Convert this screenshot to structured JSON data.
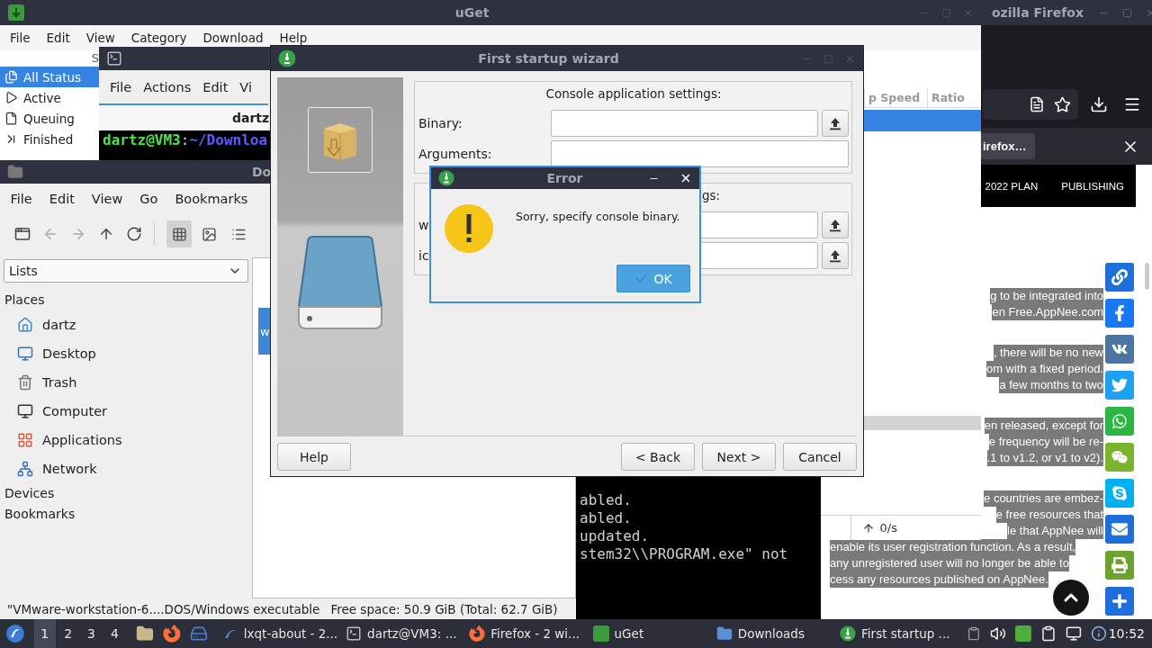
{
  "firefox": {
    "title": "ozilla Firefox",
    "notice": "irefox…",
    "nav": [
      "2022 PLAN",
      "PUBLISHING"
    ],
    "paragraphs": [
      [
        "g to be integrated into",
        "en Free.AppNee.com"
      ],
      [
        ", there will be no new",
        "om with a fixed period.",
        "a few months to two"
      ],
      [
        "en released, except for",
        "e frequency will be re-",
        ".1 to v1.2, or v1 to v2)."
      ],
      [
        "e countries are embez-",
        "e free resources that",
        "le that AppNee will",
        "enable its user registration function. As a result,",
        "any unregistered user will no longer be able to",
        "cess any resources published on AppNee."
      ]
    ]
  },
  "uget": {
    "title": "uGet",
    "menu": [
      "File",
      "Edit",
      "View",
      "Category",
      "Download",
      "Help"
    ],
    "sidebar_header": "S",
    "statuses": [
      {
        "label": "All Status",
        "selected": true
      },
      {
        "label": "Active",
        "selected": false
      },
      {
        "label": "Queuing",
        "selected": false
      },
      {
        "label": "Finished",
        "selected": false
      }
    ],
    "columns": [
      "p Speed",
      "Ratio"
    ],
    "rows": [
      {
        "selected": true
      }
    ],
    "upload_speed": "0/s"
  },
  "terminal": {
    "menu": [
      "File",
      "Actions",
      "Edit",
      "Vi"
    ],
    "tab": "dartz",
    "prompt": {
      "user": "dartz@VM3",
      "separator": ":",
      "path": "~/Downloa"
    },
    "tail_lines": [
      "abled.",
      "abled.",
      "updated.",
      "stem32\\\\PROGRAM.exe\" not"
    ]
  },
  "file_manager": {
    "title": "Do",
    "menu": [
      "File",
      "Edit",
      "View",
      "Go",
      "Bookmarks"
    ],
    "toolbar": {
      "nav": [
        {
          "disabled": true
        },
        {
          "disabled": true
        },
        {
          "disabled": false
        },
        {
          "disabled": false
        }
      ],
      "views": [
        {
          "selected": true
        },
        {
          "selected": false
        },
        {
          "selected": false
        }
      ]
    },
    "side_view": "Lists",
    "places_header": "Places",
    "places": [
      "dartz",
      "Desktop",
      "Trash",
      "Computer",
      "Applications",
      "Network"
    ],
    "sections": [
      "Devices",
      "Bookmarks"
    ],
    "selected_file": "w",
    "status": [
      "\"VMware-workstation-6....DOS/Windows executable",
      "Free space: 50.9 GiB (Total: 62.7 GiB)"
    ]
  },
  "wizard": {
    "title": "First startup wizard",
    "groups": [
      {
        "title": "Console application settings:",
        "fields": [
          {
            "label": "Binary:",
            "kind": "browse"
          },
          {
            "label": "Arguments:",
            "kind": "plain"
          }
        ]
      },
      {
        "title": "gs:",
        "fields": [
          {
            "label": "w",
            "kind": "browse"
          },
          {
            "label": "ic",
            "kind": "browse"
          }
        ]
      }
    ],
    "help": "Help",
    "buttons": [
      "< Back",
      "Next >",
      "Cancel"
    ]
  },
  "error": {
    "title": "Error",
    "message": "Sorry, specify console binary.",
    "button": "OK"
  },
  "taskbar": {
    "desktops": [
      {
        "label": "1",
        "selected": true
      },
      {
        "label": "2",
        "selected": false
      },
      {
        "label": "3",
        "selected": false
      },
      {
        "label": "4",
        "selected": false
      }
    ],
    "tasks": [
      "lxqt-about - 2...",
      "dartz@VM3: ...",
      "Firefox - 2 wi...",
      "uGet",
      "Downloads",
      "First startup ..."
    ],
    "clock": "10:52"
  }
}
